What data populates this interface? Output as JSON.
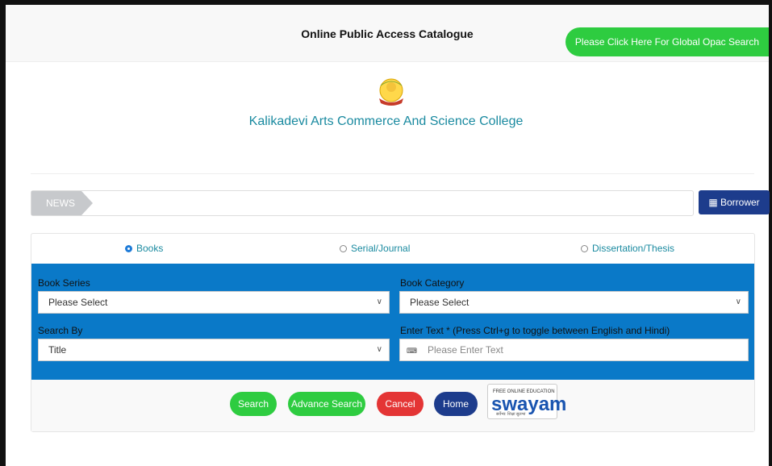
{
  "header": {
    "title": "Online Public Access Catalogue",
    "global_button": "Please Click Here For Global Opac Search"
  },
  "college": {
    "name": "Kalikadevi Arts Commerce And Science College"
  },
  "news": {
    "label": "NEWS"
  },
  "borrower_login": {
    "label": "Borrower Login",
    "icon": "id-card-icon"
  },
  "tabs": [
    {
      "label": "Books",
      "selected": true
    },
    {
      "label": "Serial/Journal",
      "selected": false
    },
    {
      "label": "Dissertation/Thesis",
      "selected": false
    }
  ],
  "form": {
    "book_series": {
      "label": "Book Series",
      "value": "Please Select"
    },
    "book_category": {
      "label": "Book Category",
      "value": "Please Select"
    },
    "search_by": {
      "label": "Search By",
      "value": "Title"
    },
    "enter_text": {
      "label": "Enter Text * (Press Ctrl+g to toggle between English and Hindi)",
      "placeholder": "Please Enter Text",
      "icon": "keyboard-icon"
    }
  },
  "buttons": {
    "search": "Search",
    "advance": "Advance Search",
    "cancel": "Cancel",
    "home": "Home"
  },
  "swayam": {
    "tag": "FREE ONLINE EDUCATION",
    "logo": "swayam",
    "sub": "सर्वेभ्य: शिक्षा सुलभा"
  },
  "colors": {
    "blue_panel": "#0a79c8",
    "green": "#2ecc40",
    "red": "#e43535",
    "navy": "#1d3c8c",
    "teal_text": "#1a8aa0"
  }
}
